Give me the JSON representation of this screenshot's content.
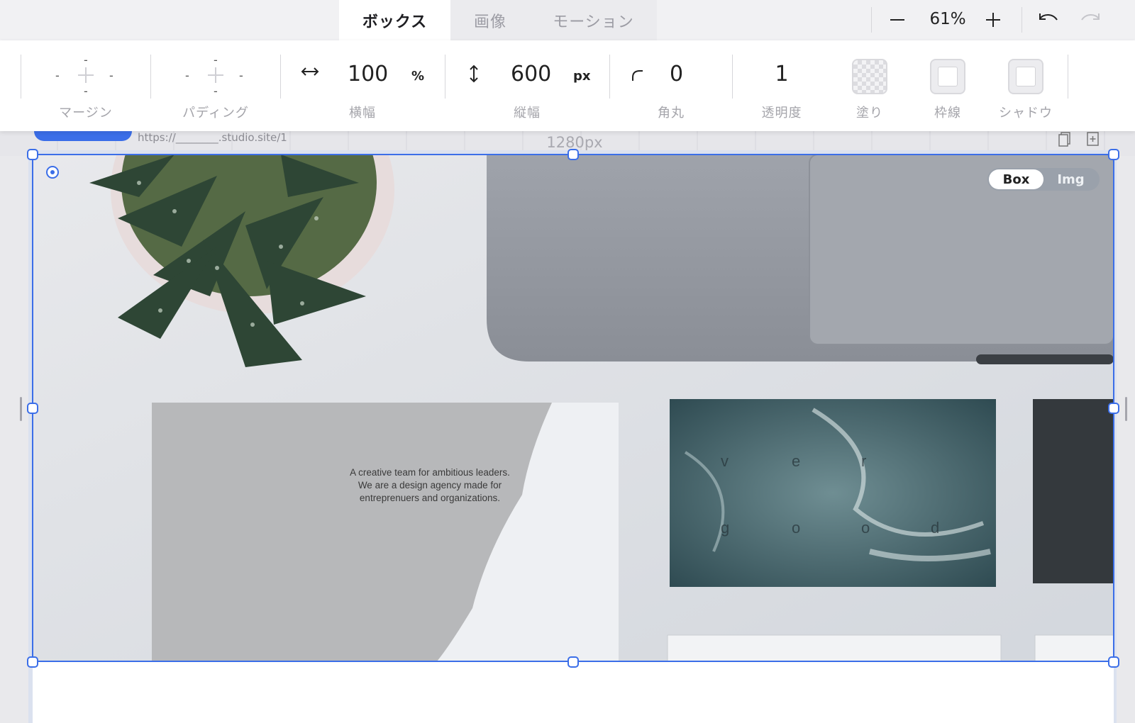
{
  "tabs": [
    {
      "label": "ボックス",
      "active": true
    },
    {
      "label": "画像",
      "active": false
    },
    {
      "label": "モーション",
      "active": false
    }
  ],
  "zoom": {
    "value": "61%"
  },
  "properties": {
    "margin": {
      "label": "マージン",
      "top": "-",
      "right": "-",
      "bottom": "-",
      "left": "-"
    },
    "padding": {
      "label": "パディング",
      "top": "-",
      "right": "-",
      "bottom": "-",
      "left": "-"
    },
    "width": {
      "label": "横幅",
      "value": "100",
      "unit": "%"
    },
    "height": {
      "label": "縦幅",
      "value": "600",
      "unit": "px"
    },
    "radius": {
      "label": "角丸",
      "value": "0"
    },
    "opacity": {
      "label": "透明度",
      "value": "1"
    },
    "fill": {
      "label": "塗り"
    },
    "border": {
      "label": "枠線"
    },
    "shadow": {
      "label": "シャドウ"
    }
  },
  "canvas": {
    "url": "https://________.studio.site/1",
    "width_label": "1280px",
    "mode_toggle": [
      "Box",
      "Img"
    ],
    "mode_selected": "Box"
  },
  "image_content": {
    "card_text": [
      "A creative team for ambitious leaders.",
      "We are a design agency made for",
      "entreprenuers and organizations."
    ],
    "ocean_letters_top": [
      "v",
      "e",
      "r"
    ],
    "ocean_letters_bottom": [
      "g",
      "o",
      "o",
      "d"
    ]
  },
  "colors": {
    "accent": "#3b6ee8"
  },
  "icons": [
    "minus-icon",
    "plus-icon",
    "undo-icon",
    "redo-icon",
    "horizontal-arrow-icon",
    "vertical-arrow-icon",
    "corner-radius-icon",
    "page-add-icon"
  ]
}
